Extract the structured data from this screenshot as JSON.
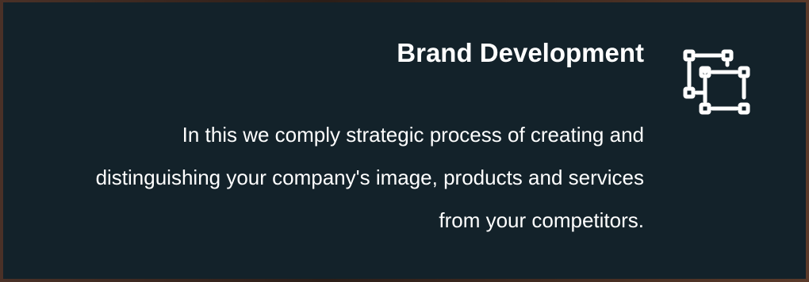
{
  "card": {
    "title": "Brand Development",
    "description": "In this we comply strategic process of creating and distinguishing your company's image, products and services from your competitors.",
    "icon": "hierarchy-structure-icon"
  },
  "colors": {
    "card_background": "#13222a",
    "text": "#ffffff",
    "icon_stroke": "#ffffff"
  }
}
